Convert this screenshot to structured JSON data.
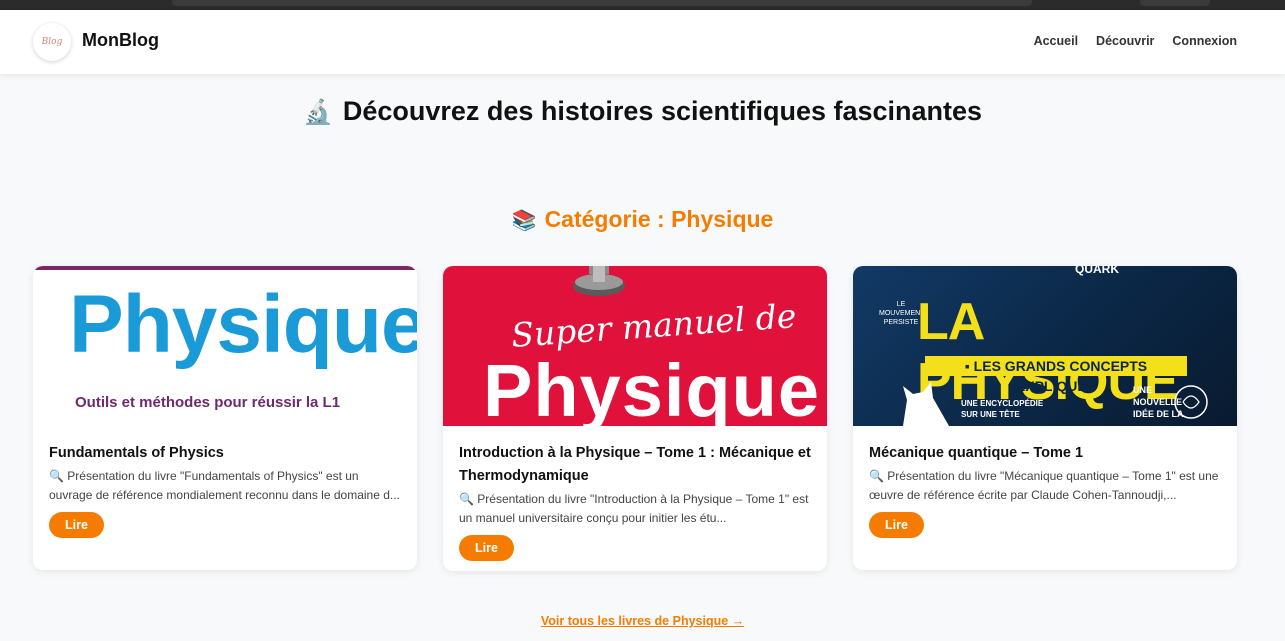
{
  "header": {
    "logo_text": "Blog",
    "brand": "MonBlog",
    "nav": [
      "Accueil",
      "Découvrir",
      "Connexion"
    ]
  },
  "hero": {
    "emoji": "🔬",
    "title": "Découvrez des histoires scientifiques fascinantes"
  },
  "category": {
    "emoji": "📚",
    "title": "Catégorie : Physique"
  },
  "cards": [
    {
      "cover": {
        "big": "Physique",
        "sub": "Outils et méthodes pour réussir la L1"
      },
      "title": "Fundamentals of Physics",
      "desc": "🔍 Présentation du livre \"Fundamentals of Physics\" est un ouvrage de référence mondialement reconnu dans le domaine d...",
      "button": "Lire"
    },
    {
      "cover": {
        "script": "Super manuel de",
        "big": "Physique"
      },
      "title": "Introduction à la Physique – Tome 1 : Mécanique et Thermodynamique",
      "desc": "🔍 Présentation du livre \"Introduction à la Physique – Tome 1\" est un manuel universitaire conçu pour initier les étu...",
      "button": "Lire"
    },
    {
      "cover": {
        "quark": "QUARK",
        "title": "LA PHYSIQUE",
        "bar": "▪ LES GRANDS CONCEPTS EXPLIQUÉS",
        "small1": "LE MOUVEMENT PERSISTE",
        "small2": "UNE ENCYCLOPÉDIE SUR UNE TÊTE",
        "small3": "UNE NOUVELLE IDÉE DE LA"
      },
      "title": "Mécanique quantique – Tome 1",
      "desc": "🔍 Présentation du livre \"Mécanique quantique – Tome 1\" est une œuvre de référence écrite par Claude Cohen-Tannoudji,...",
      "button": "Lire"
    }
  ],
  "see_all": "Voir tous les livres de Physique →",
  "colors": {
    "accent": "#f57c00",
    "page_bg": "#f8f9fb"
  }
}
